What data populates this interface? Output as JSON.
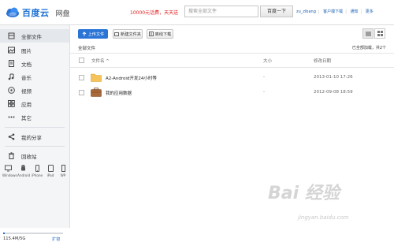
{
  "header": {
    "brand": "百度云",
    "sub": "网盘",
    "promo": "10000元话费，天天送",
    "search_placeholder": "搜索全部文件",
    "search_button": "百度一下",
    "user_links": [
      "zu_zibang",
      "客户端下载",
      "通知",
      "更多"
    ]
  },
  "sidebar": {
    "items": [
      {
        "label": "全部文件",
        "icon": "files-icon",
        "active": true
      },
      {
        "label": "图片",
        "icon": "image-icon",
        "active": false
      },
      {
        "label": "文档",
        "icon": "document-icon",
        "active": false
      },
      {
        "label": "音乐",
        "icon": "music-icon",
        "active": false
      },
      {
        "label": "视频",
        "icon": "video-icon",
        "active": false
      },
      {
        "label": "应用",
        "icon": "apps-icon",
        "active": false
      },
      {
        "label": "其它",
        "icon": "more-icon",
        "active": false
      }
    ],
    "share": {
      "label": "我的分享",
      "icon": "share-icon"
    },
    "recycle": {
      "label": "回收站",
      "icon": "trash-icon"
    },
    "devices": [
      "Windows",
      "Android",
      "iPhone",
      "iPad",
      "WP"
    ],
    "quota": {
      "text": "115.4M/5G",
      "used_fraction": 0.02,
      "expand": "扩容"
    }
  },
  "toolbar": {
    "upload": "上传文件",
    "new_folder": "新建文件夹",
    "offline": "离线下载"
  },
  "breadcrumb": "全部文件",
  "loaded_text": "已全部加载，共2个",
  "columns": {
    "name": "文件名",
    "sort_arrow": "^",
    "size": "大小",
    "mtime": "修改日期"
  },
  "files": [
    {
      "name": "A2-Android开发24小时等",
      "size": "-",
      "mtime": "2013-01-10 17:26",
      "type": "folder"
    },
    {
      "name": "我的应用数据",
      "size": "-",
      "mtime": "2012-09-08 18:59",
      "type": "app-folder"
    }
  ],
  "watermark": {
    "logo": "Bai 经验",
    "url": "jingyan.baidu.com"
  }
}
